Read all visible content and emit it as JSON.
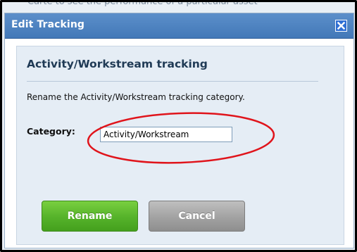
{
  "backdrop": {
    "partial_text": "Carte to see the performance of a particular asset"
  },
  "dialog": {
    "title": "Edit Tracking",
    "close_icon": "close-icon",
    "heading": "Activity/Workstream tracking",
    "description": "Rename the Activity/Workstream tracking category.",
    "category_label": "Category:",
    "category_value": "Activity/Workstream",
    "buttons": {
      "rename": "Rename",
      "cancel": "Cancel"
    }
  },
  "colors": {
    "titlebar": "#4a80c0",
    "panel": "#e5edf5",
    "rename_button": "#55b22a",
    "cancel_button": "#a2a2a2",
    "annotation_ellipse": "#e0141b"
  }
}
